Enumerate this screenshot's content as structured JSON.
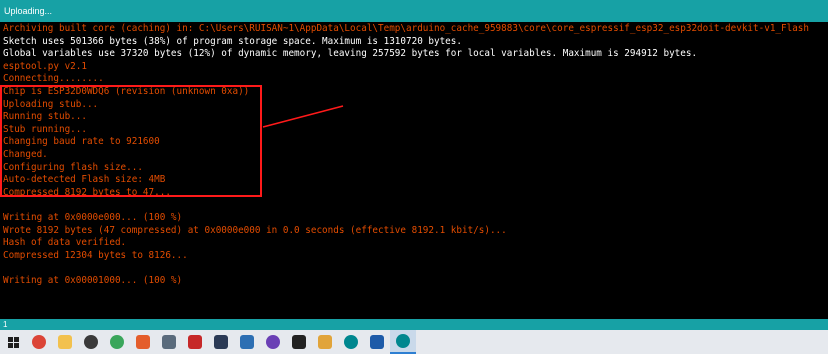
{
  "status": {
    "text": "Uploading..."
  },
  "console": {
    "lines": [
      {
        "text": "Archiving built core (caching) in: C:\\Users\\RUISAN~1\\AppData\\Local\\Temp\\arduino_cache_959883\\core\\core_espressif_esp32_esp32doit-devkit-v1_Flash",
        "color": "orange"
      },
      {
        "text": "Sketch uses 501366 bytes (38%) of program storage space. Maximum is 1310720 bytes.",
        "color": "white"
      },
      {
        "text": "Global variables use 37320 bytes (12%) of dynamic memory, leaving 257592 bytes for local variables. Maximum is 294912 bytes.",
        "color": "white"
      },
      {
        "text": "esptool.py v2.1",
        "color": "orange"
      },
      {
        "text": "Connecting........",
        "color": "orange"
      },
      {
        "text": "Chip is ESP32D0WDQ6 (revision (unknown 0xa))",
        "color": "orange"
      },
      {
        "text": "Uploading stub...",
        "color": "orange"
      },
      {
        "text": "Running stub...",
        "color": "orange"
      },
      {
        "text": "Stub running...",
        "color": "orange"
      },
      {
        "text": "Changing baud rate to 921600",
        "color": "orange"
      },
      {
        "text": "Changed.",
        "color": "orange"
      },
      {
        "text": "Configuring flash size...",
        "color": "orange"
      },
      {
        "text": "Auto-detected Flash size: 4MB",
        "color": "orange"
      },
      {
        "text": "Compressed 8192 bytes to 47...",
        "color": "orange"
      },
      {
        "text": "",
        "color": "orange"
      },
      {
        "text": "Writing at 0x0000e000... (100 %)",
        "color": "orange"
      },
      {
        "text": "Wrote 8192 bytes (47 compressed) at 0x0000e000 in 0.0 seconds (effective 8192.1 kbit/s)...",
        "color": "orange"
      },
      {
        "text": "Hash of data verified.",
        "color": "orange"
      },
      {
        "text": "Compressed 12304 bytes to 8126...",
        "color": "orange"
      },
      {
        "text": "",
        "color": "orange"
      },
      {
        "text": "Writing at 0x00001000... (100 %)",
        "color": "orange"
      }
    ]
  },
  "line_indicator": {
    "text": "1"
  },
  "taskbar": {
    "icons": [
      {
        "name": "windows-start-icon",
        "color": "#1f1f1f"
      },
      {
        "name": "chrome-icon",
        "color": "#db4437"
      },
      {
        "name": "file-explorer-icon",
        "color": "#f2c14e"
      },
      {
        "name": "media-player-icon",
        "color": "#3a3a3a"
      },
      {
        "name": "green-circle-app-icon",
        "color": "#3aa65b"
      },
      {
        "name": "git-icon",
        "color": "#e45d2b"
      },
      {
        "name": "remote-desktop-icon",
        "color": "#5a6b7c"
      },
      {
        "name": "filezilla-icon",
        "color": "#c62828"
      },
      {
        "name": "terminal-icon",
        "color": "#2b3a55"
      },
      {
        "name": "ide-icon",
        "color": "#2d6fb3"
      },
      {
        "name": "obs-icon",
        "color": "#6a3fb5"
      },
      {
        "name": "monitor-icon",
        "color": "#222222"
      },
      {
        "name": "document-icon",
        "color": "#e1a43a"
      },
      {
        "name": "arduino-icon",
        "color": "#00878f"
      },
      {
        "name": "notepad-icon",
        "color": "#1e5ba8"
      },
      {
        "name": "arduino-active-icon",
        "color": "#00878f"
      }
    ]
  }
}
